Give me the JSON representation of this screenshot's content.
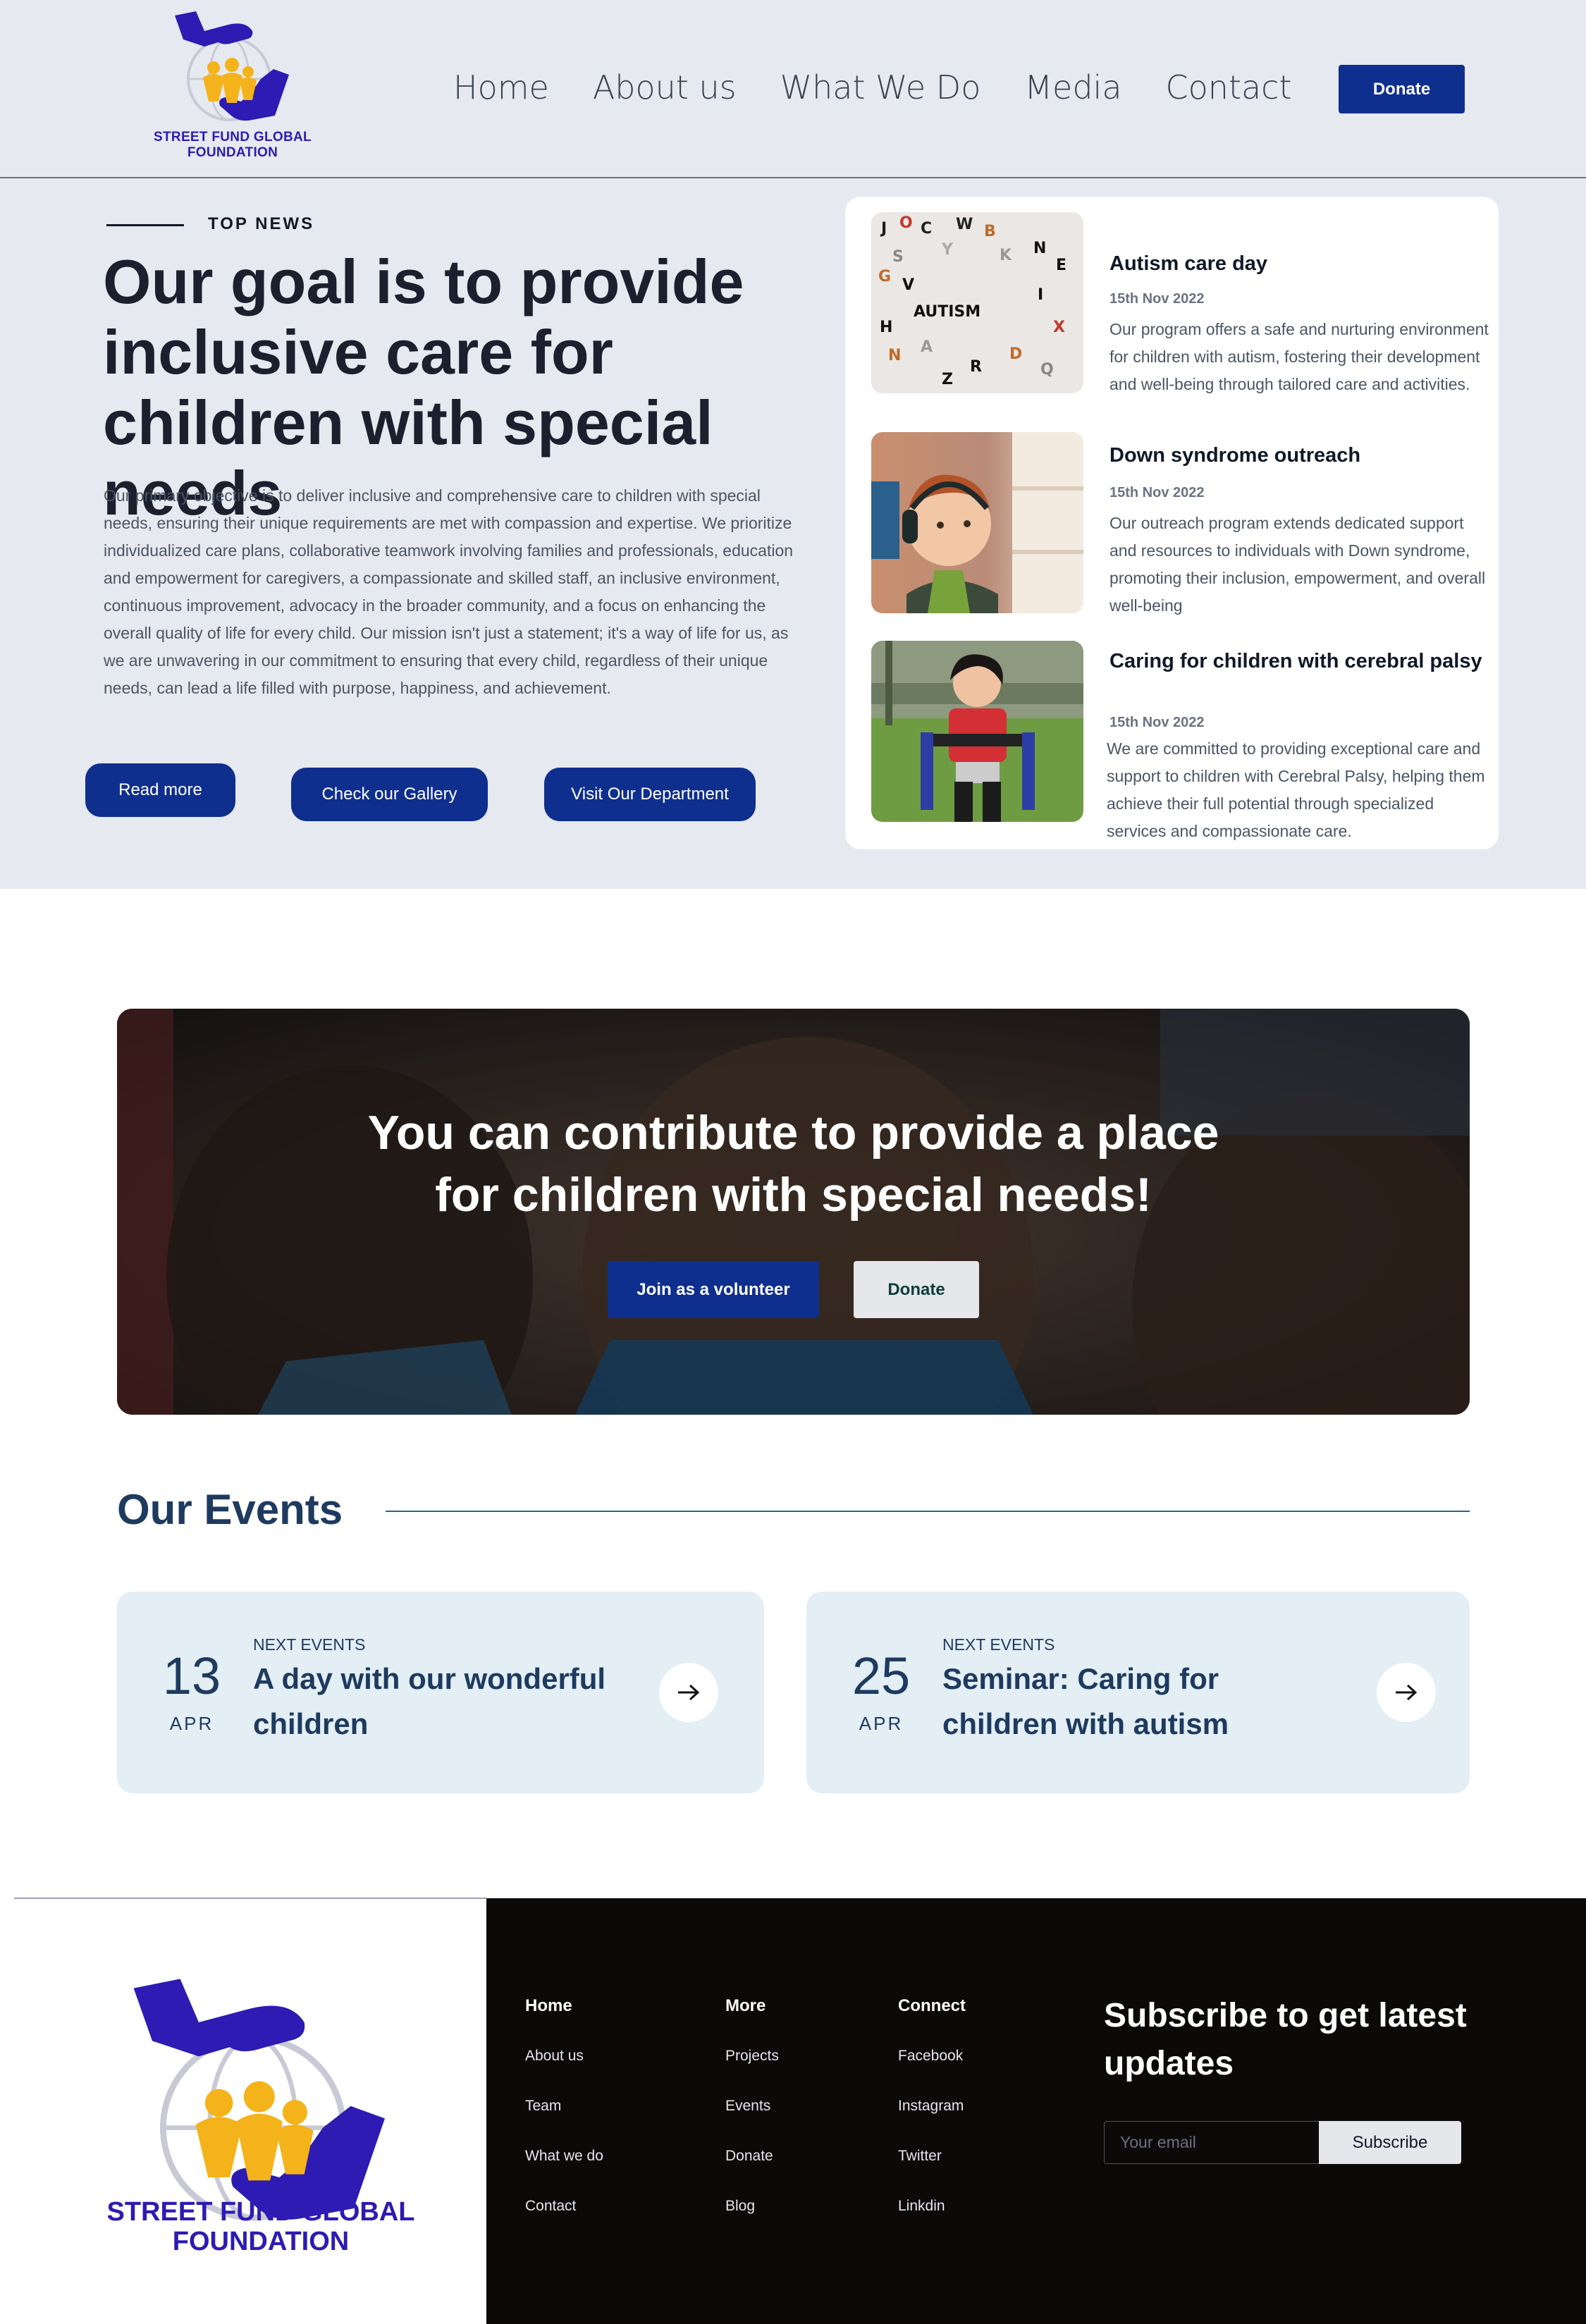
{
  "header": {
    "logo_text_line1": "STREET FUND GLOBAL",
    "logo_text_line2": "FOUNDATION",
    "nav": [
      "Home",
      "About us",
      "What We Do",
      "Media",
      "Contact"
    ],
    "donate_label": "Donate"
  },
  "hero": {
    "eyebrow": "TOP NEWS",
    "title": "Our goal is to provide inclusive care for children with special needs",
    "description": "Our primary objective is to deliver inclusive and comprehensive care to children with special needs, ensuring their unique requirements are met with compassion and expertise. We prioritize individualized care plans, collaborative teamwork involving families and professionals, education and empowerment for caregivers, a compassionate and skilled staff, an inclusive environment, continuous improvement, advocacy in the broader community, and a focus on enhancing the overall quality of life for every child. Our mission isn't just a statement; it's a way of life for us, as we are unwavering in our commitment to ensuring that every child, regardless of their unique needs, can lead a life filled with purpose, happiness, and achievement.",
    "buttons": {
      "read_more": "Read more",
      "gallery": "Check our Gallery",
      "department": "Visit Our Department"
    }
  },
  "news": [
    {
      "title": "Autism care day",
      "date": "15th Nov 2022",
      "text": "Our program offers a safe and nurturing environment for children with autism, fostering their development and well-being through tailored care and activities.",
      "image_word": "AUTISM"
    },
    {
      "title": "Down syndrome outreach",
      "date": "15th Nov 2022",
      "text": "Our outreach program extends dedicated support and resources to individuals with Down syndrome, promoting their inclusion, empowerment, and overall well-being"
    },
    {
      "title": "Caring for children with cerebral palsy",
      "date": "15th Nov 2022",
      "text": "We are committed to providing exceptional care and support to children with Cerebral Palsy, helping them achieve their full potential through specialized services and compassionate care."
    }
  ],
  "banner": {
    "title_line1": "You can contribute to provide a place",
    "title_line2": "for children with special needs!",
    "volunteer_label": "Join as a volunteer",
    "donate_label": "Donate"
  },
  "events": {
    "title": "Our Events",
    "items": [
      {
        "day": "13",
        "month": "APR",
        "kicker": "NEXT EVENTS",
        "title": "A day with our wonderful children"
      },
      {
        "day": "25",
        "month": "APR",
        "kicker": "NEXT EVENTS",
        "title": "Seminar: Caring for children with autism"
      }
    ]
  },
  "footer": {
    "logo_text_line1": "STREET FUND GLOBAL",
    "logo_text_line2": "FOUNDATION",
    "columns": [
      {
        "heading": "Home",
        "links": [
          "About us",
          "Team",
          "What we do",
          "Contact"
        ]
      },
      {
        "heading": "More",
        "links": [
          "Projects",
          "Events",
          "Donate",
          "Blog"
        ]
      },
      {
        "heading": "Connect",
        "links": [
          "Facebook",
          "Instagram",
          "Twitter",
          "Linkdin"
        ]
      }
    ],
    "subscribe_title": "Subscribe to get latest updates",
    "email_placeholder": "Your email",
    "subscribe_label": "Subscribe"
  },
  "colors": {
    "brand_blue": "#0f2f8f",
    "logo_purple": "#2d1bb3",
    "logo_yellow": "#f4b31a",
    "hero_bg": "#e6e9ef",
    "events_text": "#1e3a5f",
    "event_card_bg": "#e3eef5",
    "footer_bg": "#0c0909"
  }
}
